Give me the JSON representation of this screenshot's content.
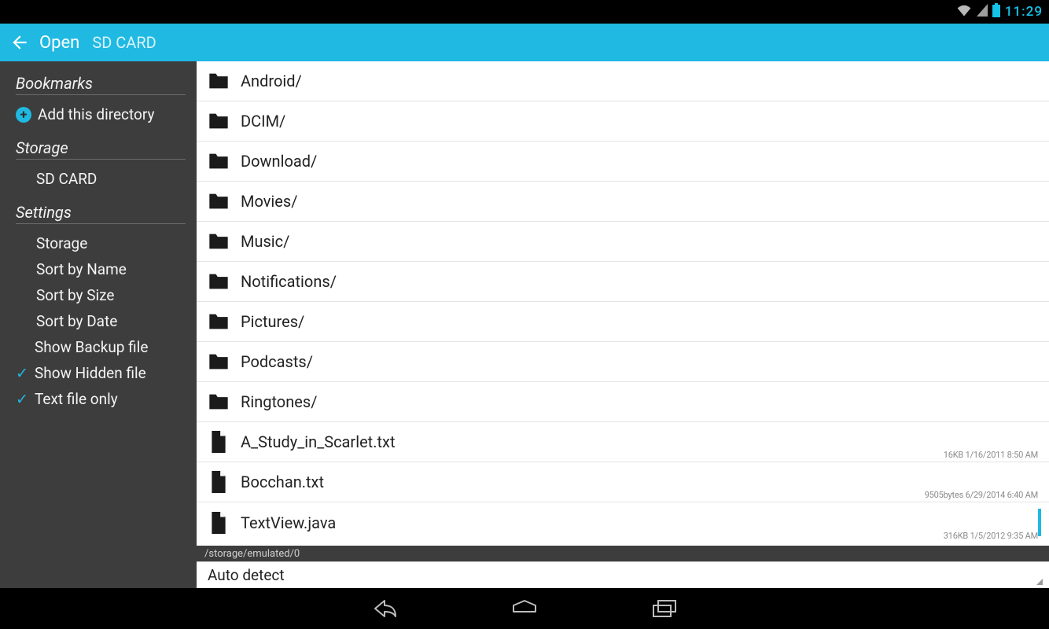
{
  "statusbar": {
    "time": "11:29"
  },
  "actionbar": {
    "title": "Open",
    "path": "SD CARD"
  },
  "sidebar": {
    "bookmarks_head": "Bookmarks",
    "add_directory": "Add this directory",
    "storage_head": "Storage",
    "storage": [
      {
        "label": "SD CARD"
      }
    ],
    "settings_head": "Settings",
    "settings": [
      {
        "label": "Storage",
        "checked": false
      },
      {
        "label": "Sort by Name",
        "checked": false
      },
      {
        "label": "Sort by Size",
        "checked": false
      },
      {
        "label": "Sort by Date",
        "checked": false
      },
      {
        "label": "Show Backup file",
        "checked": false
      },
      {
        "label": "Show Hidden file",
        "checked": true
      },
      {
        "label": "Text file only",
        "checked": true
      }
    ]
  },
  "files": [
    {
      "type": "folder",
      "name": "Android/"
    },
    {
      "type": "folder",
      "name": "DCIM/"
    },
    {
      "type": "folder",
      "name": "Download/"
    },
    {
      "type": "folder",
      "name": "Movies/"
    },
    {
      "type": "folder",
      "name": "Music/"
    },
    {
      "type": "folder",
      "name": "Notifications/"
    },
    {
      "type": "folder",
      "name": "Pictures/"
    },
    {
      "type": "folder",
      "name": "Podcasts/"
    },
    {
      "type": "folder",
      "name": "Ringtones/"
    },
    {
      "type": "file",
      "name": "A_Study_in_Scarlet.txt",
      "meta": "16KB 1/16/2011 8:50 AM"
    },
    {
      "type": "file",
      "name": "Bocchan.txt",
      "meta": "9505bytes 6/29/2014 6:40 AM"
    },
    {
      "type": "file",
      "name": "TextView.java",
      "meta": "316KB 1/5/2012 9:35 AM",
      "highlight": true
    }
  ],
  "pathbar": {
    "path": "/storage/emulated/0"
  },
  "encoding": {
    "value": "Auto detect"
  }
}
